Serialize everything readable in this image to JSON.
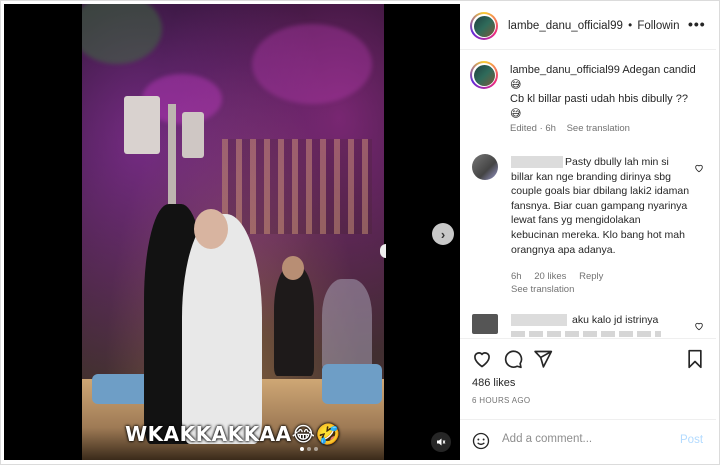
{
  "post": {
    "username": "lambe_danu_official99",
    "header_separator": "•",
    "follow_label": "Followin",
    "more_label": "•••",
    "caption_line1": "lambe_danu_official99 Adegan candid 😅",
    "caption_line2": "Cb kl billar pasti udah hbis dibully ??",
    "caption_line3": "😅",
    "caption_edited": "Edited · 6h",
    "caption_translate": "See translation",
    "video_caption": "WKAKKAKKAA😂🤣",
    "likes": "486 likes",
    "timestamp": "6 HOURS AGO"
  },
  "comments": [
    {
      "text": "Pasty dbully lah min si billar kan nge branding dirinya sbg couple goals biar dbilang laki2 idaman fansnya. Biar cuan gampang nyarinya lewat fans yg mengidolakan kebucinan mereka. Klo bang hot mah orangnya apa adanya.",
      "time": "6h",
      "likes": "20 likes",
      "reply": "Reply",
      "translate": "See translation"
    },
    {
      "text": "aku kalo jd istrinya"
    }
  ],
  "add_comment": {
    "placeholder": "Add a comment...",
    "post_label": "Post"
  },
  "icons": {
    "next": "chevron-right-icon",
    "sound": "speaker-muted-icon",
    "like": "heart-icon",
    "comment": "comment-icon",
    "share": "send-icon",
    "save": "bookmark-icon",
    "emoji": "emoji-icon"
  },
  "colors": {
    "text": "#262626",
    "muted": "#737373",
    "post_button": "#b3dbff"
  }
}
